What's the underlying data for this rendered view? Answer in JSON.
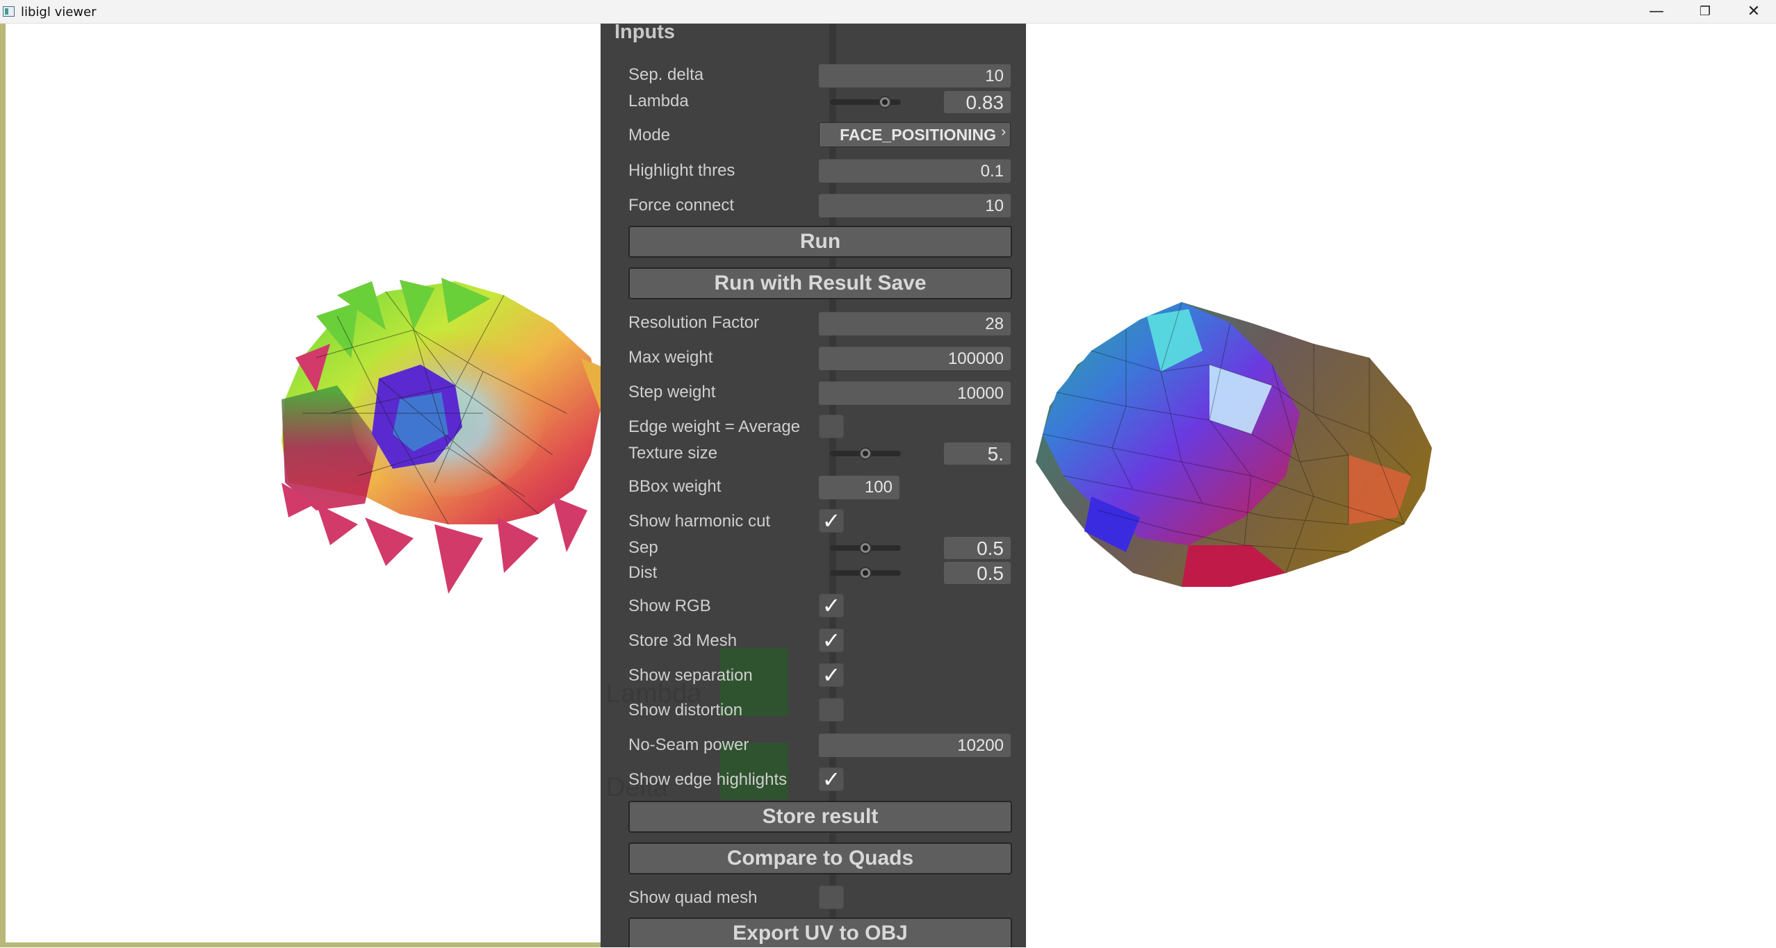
{
  "window": {
    "title": "libigl viewer",
    "minimize_glyph": "—",
    "restore_glyph": "❐",
    "close_glyph": "✕"
  },
  "panel": {
    "title": "Inputs",
    "sep_delta": {
      "label": "Sep. delta",
      "value": "10"
    },
    "lambda": {
      "label": "Lambda",
      "value": "0.83",
      "level": 0.83
    },
    "mode": {
      "label": "Mode",
      "value": "FACE_POSITIONING",
      "chevron": "›"
    },
    "highlight_thres": {
      "label": "Highlight thres",
      "value": "0.1"
    },
    "force_connect": {
      "label": "Force connect",
      "value": "10"
    },
    "run_label": "Run",
    "run_save_label": "Run with Result Save",
    "resolution_factor": {
      "label": "Resolution Factor",
      "value": "28"
    },
    "max_weight": {
      "label": "Max weight",
      "value": "100000"
    },
    "step_weight": {
      "label": "Step weight",
      "value": "10000"
    },
    "edge_weight_avg": {
      "label": "Edge weight = Average",
      "checked": false
    },
    "texture_size": {
      "label": "Texture size",
      "value": "5.",
      "level": 0.5
    },
    "bbox_weight": {
      "label": "BBox weight",
      "value": "100"
    },
    "show_harmonic_cut": {
      "label": "Show harmonic cut",
      "checked": true
    },
    "sep": {
      "label": "Sep",
      "value": "0.5",
      "level": 0.5
    },
    "dist": {
      "label": "Dist",
      "value": "0.5",
      "level": 0.5
    },
    "show_rgb": {
      "label": "Show RGB",
      "checked": true
    },
    "store_3d_mesh": {
      "label": "Store 3d Mesh",
      "checked": true
    },
    "show_separation": {
      "label": "Show separation",
      "checked": true
    },
    "show_distortion": {
      "label": "Show distortion",
      "checked": false
    },
    "no_seam_power": {
      "label": "No-Seam power",
      "value": "10200"
    },
    "show_edge_highlights": {
      "label": "Show edge highlights",
      "checked": true
    },
    "store_result_label": "Store result",
    "compare_quads_label": "Compare to Quads",
    "show_quad_mesh": {
      "label": "Show quad mesh",
      "checked": false
    },
    "export_uv_label": "Export UV to OBJ",
    "check_glyph": "✓"
  },
  "overlay": {
    "lambda_text": "Lambda",
    "delta_text": "Delta"
  }
}
